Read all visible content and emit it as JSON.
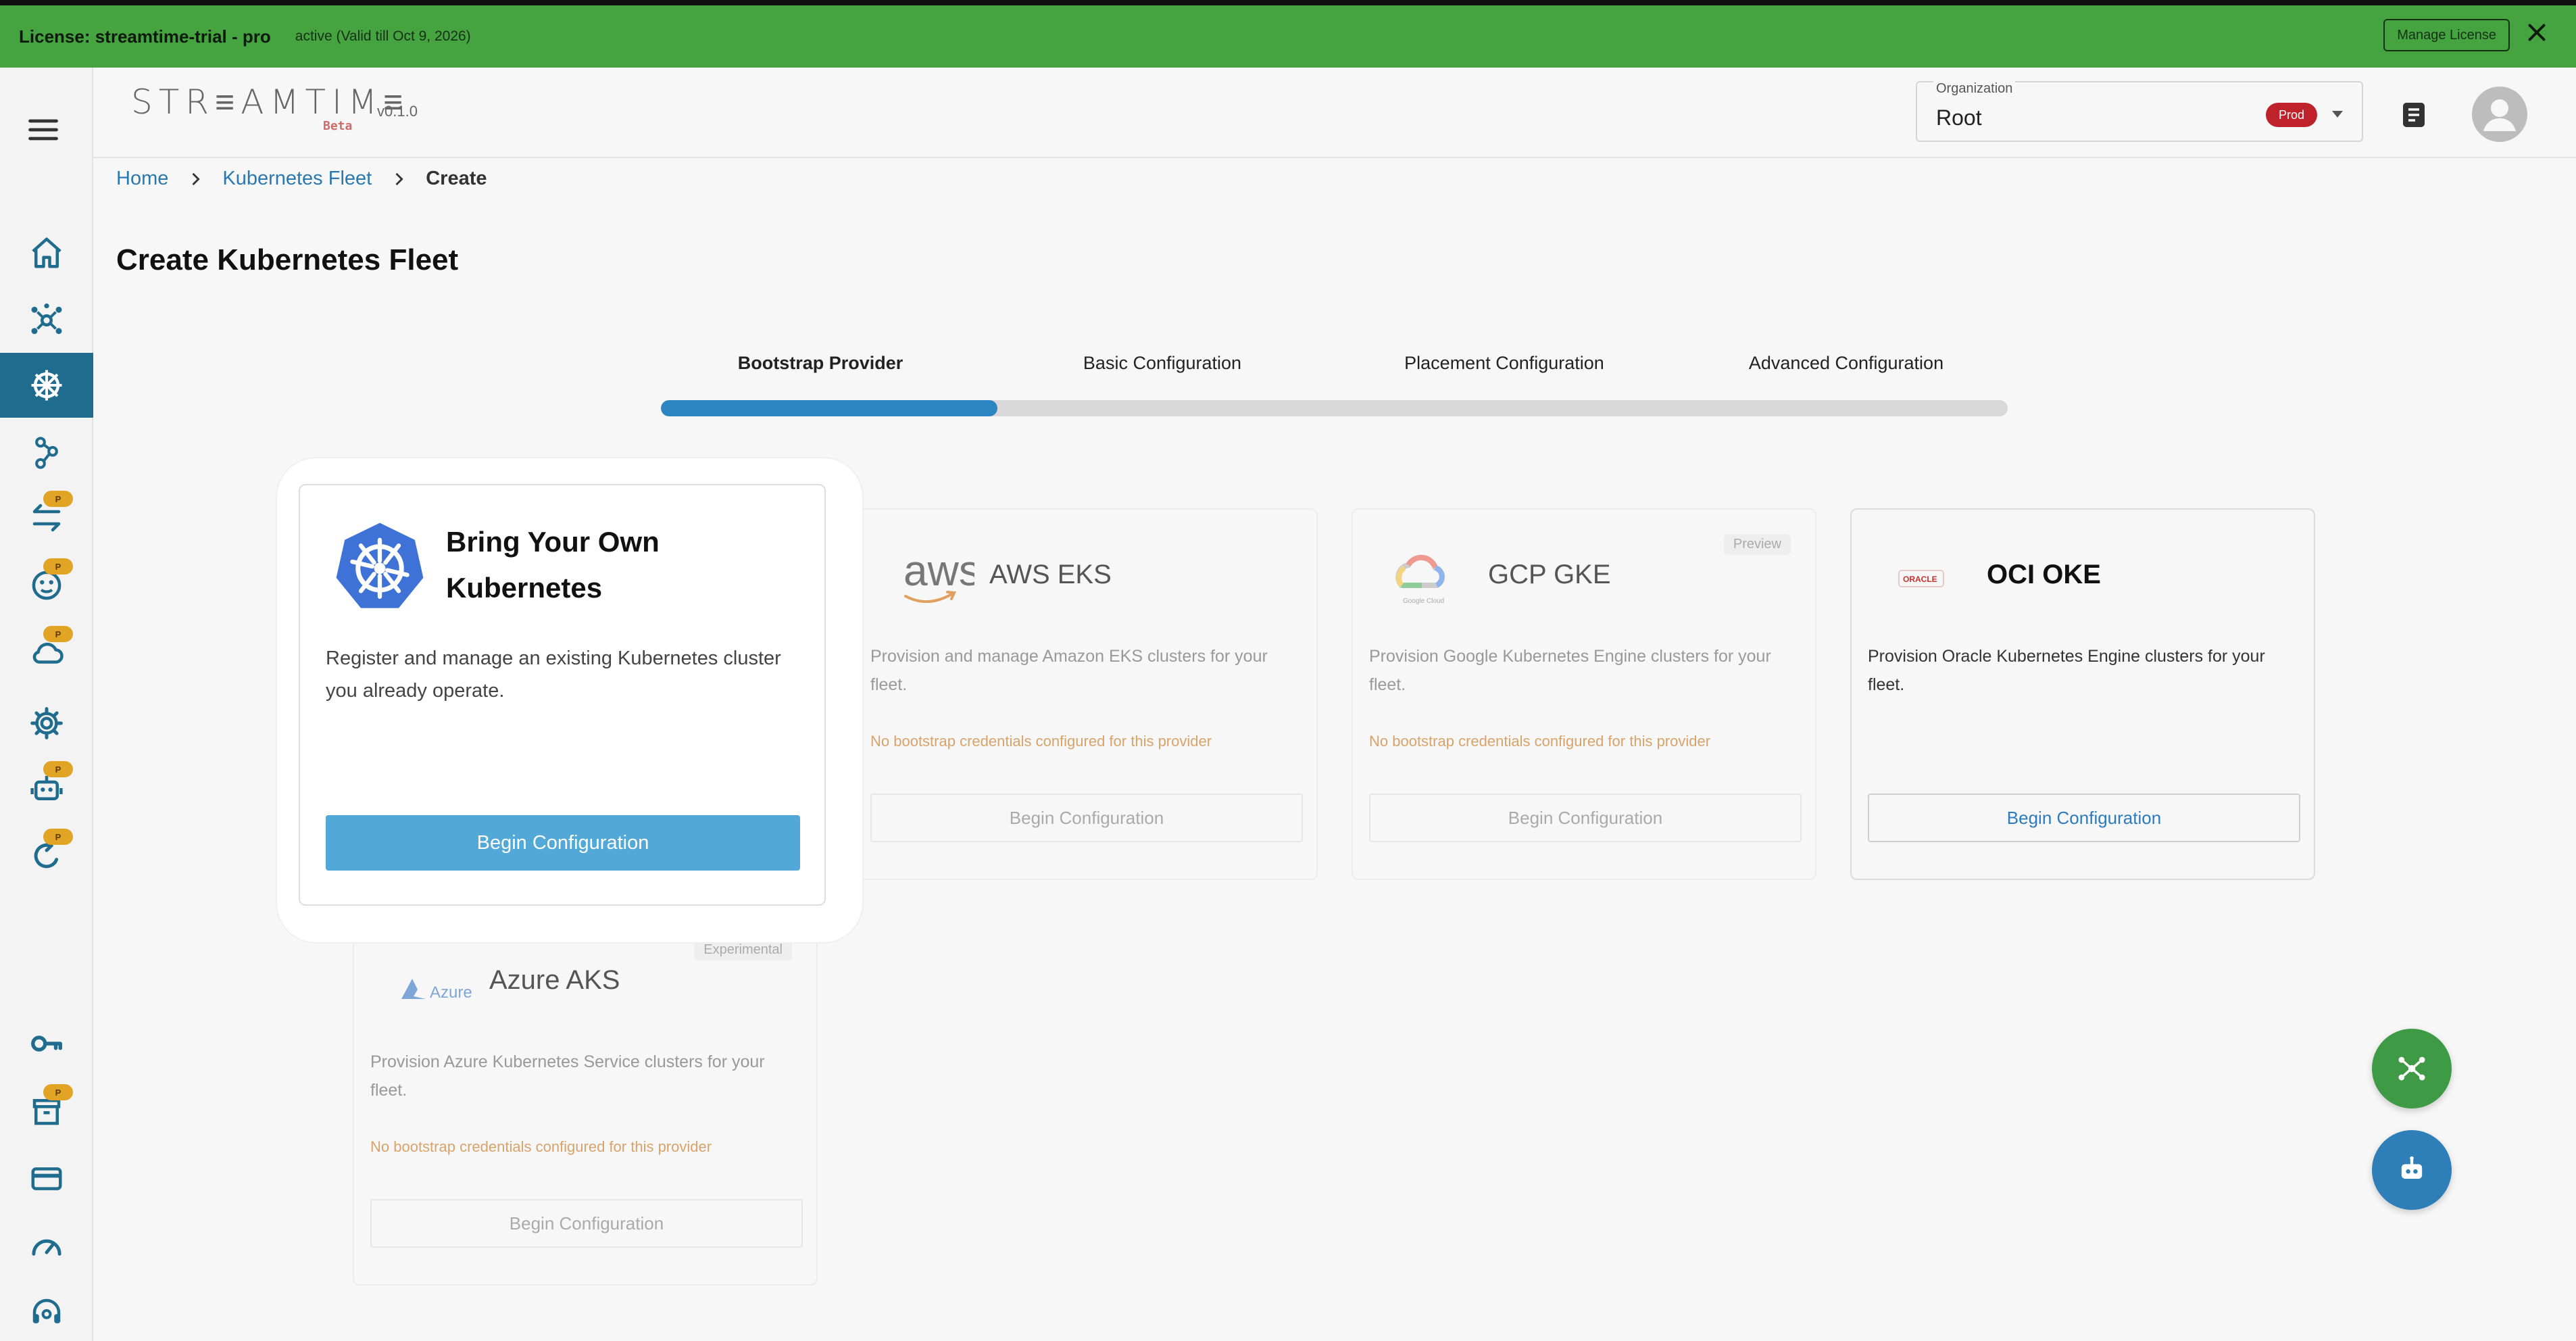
{
  "license_bar": {
    "label": "License: streamtime-trial - pro",
    "status": "active (Valid till Oct 9, 2026)",
    "manage_button": "Manage License",
    "color": "#45a340"
  },
  "header": {
    "brand": "STR≡AMTIM≡",
    "beta": "Beta",
    "version": "v0.1.0",
    "organization": {
      "label": "Organization",
      "value": "Root",
      "env_badge": "Prod",
      "env_badge_color": "#c0222b"
    }
  },
  "sidebar": {
    "accent_color": "#1f6c8f",
    "items": [
      {
        "icon": "home-icon"
      },
      {
        "icon": "topology-icon"
      },
      {
        "icon": "kubernetes-icon",
        "active": true
      },
      {
        "icon": "cluster-nodes-icon"
      },
      {
        "icon": "transfer-icon",
        "badge": "P"
      },
      {
        "icon": "brain-icon",
        "badge": "P"
      },
      {
        "icon": "cloud-icon",
        "badge": "P"
      },
      {
        "icon": "gear-icon"
      },
      {
        "icon": "robot-icon",
        "badge": "P"
      },
      {
        "icon": "refresh-icon",
        "badge": "P"
      },
      {
        "icon": "key-icon"
      },
      {
        "icon": "archive-icon",
        "badge": "P"
      },
      {
        "icon": "credit-card-icon"
      },
      {
        "icon": "speedometer-icon"
      },
      {
        "icon": "support-icon"
      }
    ]
  },
  "breadcrumb": {
    "items": [
      "Home",
      "Kubernetes Fleet",
      "Create"
    ]
  },
  "page_title": "Create Kubernetes Fleet",
  "stepper": {
    "steps": [
      "Bootstrap Provider",
      "Basic Configuration",
      "Placement Configuration",
      "Advanced Configuration"
    ],
    "active_step": 0,
    "progress_fraction": 0.25,
    "accent_color": "#2d86c2"
  },
  "providers": {
    "byok": {
      "title_line1": "Bring Your Own",
      "title_line2": "Kubernetes",
      "description": "Register and manage an existing Kubernetes cluster you already operate.",
      "button": "Begin Configuration",
      "button_color": "#52a8d7"
    },
    "aws": {
      "logo_text": "aws",
      "title": "AWS EKS",
      "description": "Provision and manage Amazon EKS clusters for your fleet.",
      "warning": "No bootstrap credentials configured for this provider",
      "button": "Begin Configuration"
    },
    "gcp": {
      "logo_caption": "Google Cloud",
      "title": "GCP GKE",
      "tag": "Preview",
      "description": "Provision Google Kubernetes Engine clusters for your fleet.",
      "warning": "No bootstrap credentials configured for this provider",
      "button": "Begin Configuration"
    },
    "oci": {
      "logo_text": "ORACLE",
      "title": "OCI OKE",
      "description": "Provision Oracle Kubernetes Engine clusters for your fleet.",
      "button": "Begin Configuration"
    },
    "azure": {
      "logo_text": "Azure",
      "title": "Azure AKS",
      "tag": "Experimental",
      "description": "Provision Azure Kubernetes Service clusters for your fleet.",
      "warning": "No bootstrap credentials configured for this provider",
      "button": "Begin Configuration"
    }
  },
  "fabs": [
    {
      "icon": "network-icon",
      "color": "#3f9a46"
    },
    {
      "icon": "robot-icon",
      "color": "#2e7fb8"
    }
  ]
}
